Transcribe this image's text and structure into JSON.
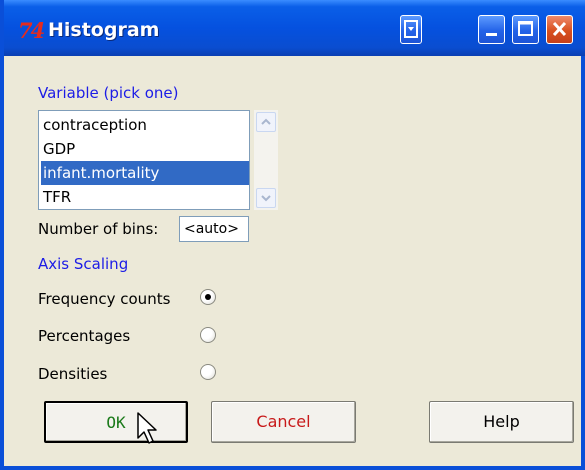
{
  "window": {
    "title": "Histogram",
    "app_icon_text": "74",
    "title_buttons": [
      "menu-icon",
      "minimize-icon",
      "maximize-icon",
      "close-icon"
    ]
  },
  "variable_section": {
    "label": "Variable (pick one)",
    "items": [
      "contraception",
      "GDP",
      "infant.mortality",
      "TFR"
    ],
    "selected": "infant.mortality"
  },
  "bins": {
    "label": "Number of bins:",
    "value": "<auto>"
  },
  "axis_scaling": {
    "label": "Axis Scaling",
    "options": [
      {
        "label": "Frequency counts",
        "checked": true
      },
      {
        "label": "Percentages",
        "checked": false
      },
      {
        "label": "Densities",
        "checked": false
      }
    ]
  },
  "buttons": {
    "ok": "OK",
    "cancel": "Cancel",
    "help": "Help"
  },
  "colors": {
    "titlebar": "#0a5fe8",
    "selection": "#316ac5",
    "section_label": "#1c1ce6",
    "ok_text": "#1a7a1a",
    "cancel_text": "#c81a1a"
  }
}
